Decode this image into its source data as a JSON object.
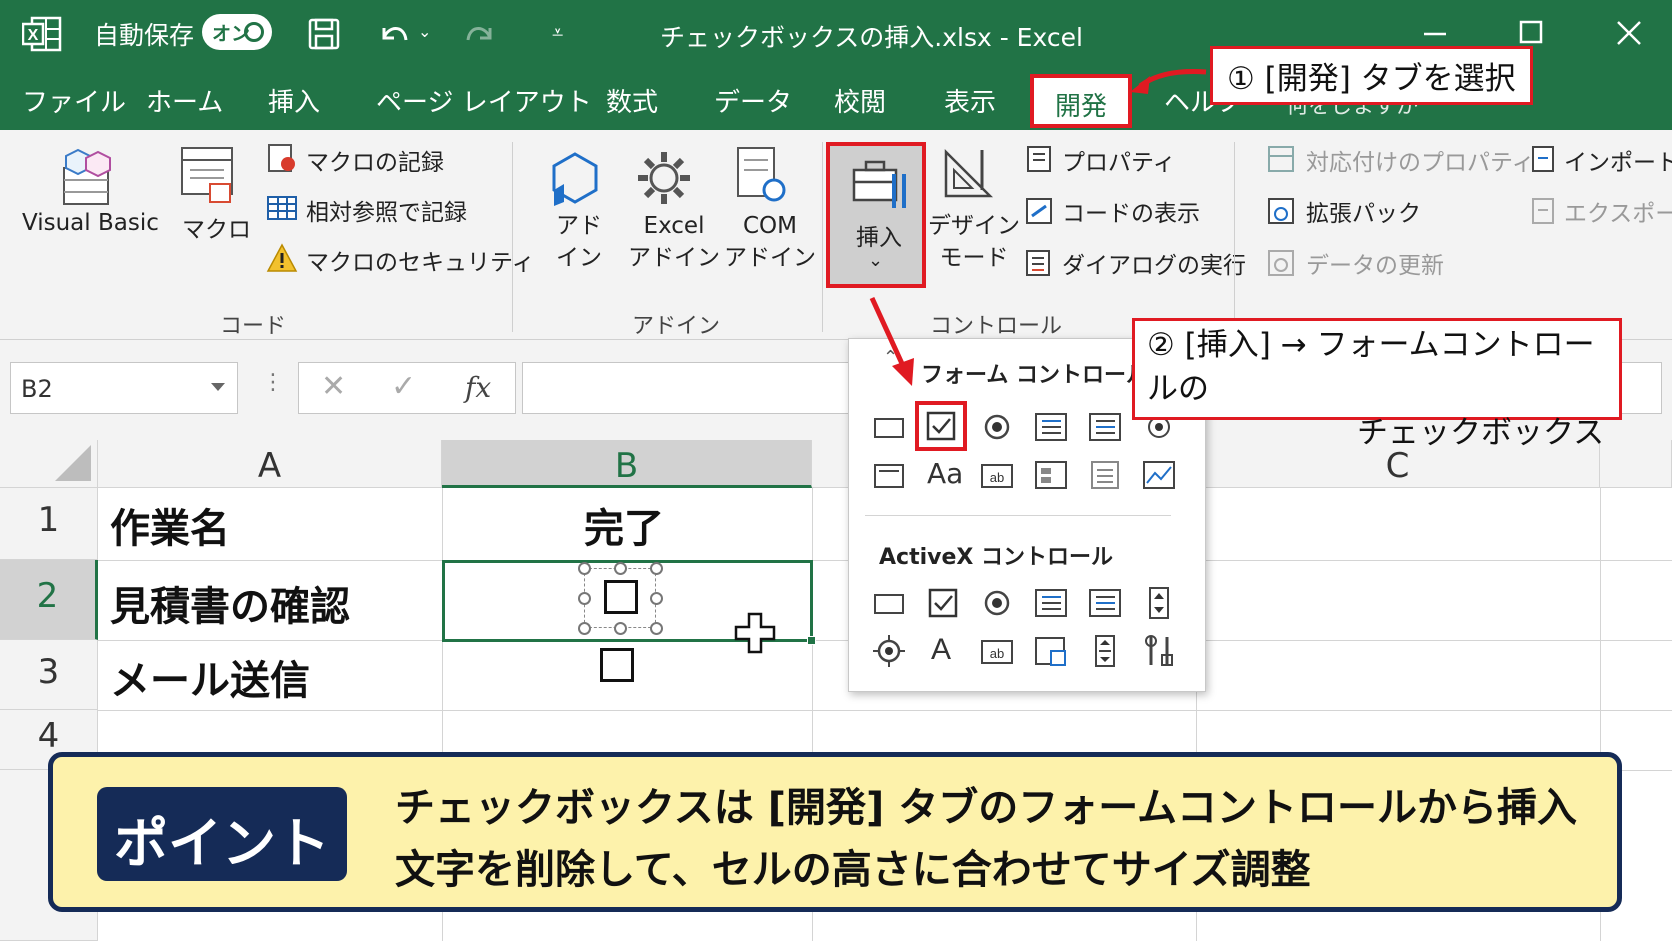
{
  "titlebar": {
    "autosave_label": "自動保存",
    "autosave_toggle": "オン",
    "doc_title": "チェックボックスの挿入.xlsx  -  Excel"
  },
  "tabs": [
    "ファイル",
    "ホーム",
    "挿入",
    "ページ レイアウト",
    "数式",
    "データ",
    "校閲",
    "表示",
    "開発",
    "ヘルプ",
    "何をしますか"
  ],
  "active_tab": "開発",
  "ribbon": {
    "code": {
      "visual_basic": "Visual Basic",
      "macro": "マクロ",
      "record_macro": "マクロの記録",
      "relative_ref": "相対参照で記録",
      "macro_security": "マクロのセキュリティ",
      "group_label": "コード"
    },
    "addins": {
      "addin": [
        "アド",
        "イン"
      ],
      "excel_addin": [
        "Excel",
        "アドイン"
      ],
      "com_addin": [
        "COM",
        "アドイン"
      ],
      "group_label": "アドイン"
    },
    "controls": {
      "insert": "挿入",
      "design_mode": [
        "デザイン",
        "モード"
      ],
      "properties": "プロパティ",
      "view_code": "コードの表示",
      "run_dialog": "ダイアログの実行",
      "group_label": "コントロール"
    },
    "xml": {
      "map_properties": "対応付けのプロパティ",
      "expansion_pack": "拡張パック",
      "refresh_data": "データの更新",
      "import": "インポート",
      "export": "エクスポート"
    }
  },
  "formula_bar": {
    "name_box": "B2",
    "fx": "fx"
  },
  "sheet": {
    "columns": [
      "A",
      "B",
      "C"
    ],
    "rows": [
      "1",
      "2",
      "3",
      "4"
    ],
    "cells": {
      "a1": "作業名",
      "b1": "完了",
      "a2": "見積書の確認",
      "a3": "メール送信"
    },
    "selected_cell": "B2"
  },
  "dropdown": {
    "form_controls": "フォーム コントロール",
    "activex_controls": "ActiveX コントロール"
  },
  "callouts": {
    "step1": "① [開発] タブを選択",
    "step2_line1": "② [挿入] → フォームコントロールの",
    "step2_line2": "チェックボックス"
  },
  "point": {
    "badge": "ポイント",
    "line1": "チェックボックスは [開発] タブのフォームコントロールから挿入",
    "line2": "文字を削除して、セルの高さに合わせてサイズ調整"
  },
  "colors": {
    "excel_green": "#217346",
    "highlight_red": "#e01a22",
    "point_bg": "#fdf2ab",
    "point_navy": "#152b57"
  }
}
